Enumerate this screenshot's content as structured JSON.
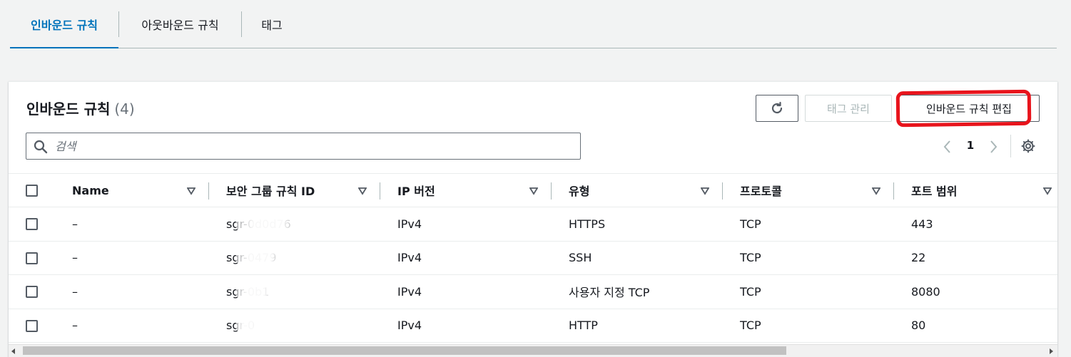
{
  "tabs": [
    {
      "label": "인바운드 규칙",
      "active": true
    },
    {
      "label": "아웃바운드 규칙",
      "active": false
    },
    {
      "label": "태그",
      "active": false
    }
  ],
  "panel": {
    "title": "인바운드 규칙",
    "count": "(4)",
    "buttons": {
      "refresh_icon": "refresh-icon",
      "manage_tags": "태그 관리",
      "edit_inbound": "인바운드 규칙 편집"
    },
    "search": {
      "placeholder": "검색",
      "value": ""
    },
    "pager": {
      "current_page": "1"
    }
  },
  "table": {
    "columns": [
      "Name",
      "보안 그룹 규칙 ID",
      "IP 버전",
      "유형",
      "프로토콜",
      "포트 범위"
    ],
    "rows": [
      {
        "name": "–",
        "rule_id": "sgr-0d0d76",
        "ip_version": "IPv4",
        "type": "HTTPS",
        "protocol": "TCP",
        "port_range": "443"
      },
      {
        "name": "–",
        "rule_id": "sgr-0479",
        "ip_version": "IPv4",
        "type": "SSH",
        "protocol": "TCP",
        "port_range": "22"
      },
      {
        "name": "–",
        "rule_id": "sgr-0b1",
        "ip_version": "IPv4",
        "type": "사용자 지정 TCP",
        "protocol": "TCP",
        "port_range": "8080"
      },
      {
        "name": "–",
        "rule_id": "sgr-0",
        "ip_version": "IPv4",
        "type": "HTTP",
        "protocol": "TCP",
        "port_range": "80"
      }
    ]
  },
  "colors": {
    "accent": "#0073bb",
    "annotation": "#e8141c",
    "text": "#16191f",
    "muted": "#687078"
  }
}
